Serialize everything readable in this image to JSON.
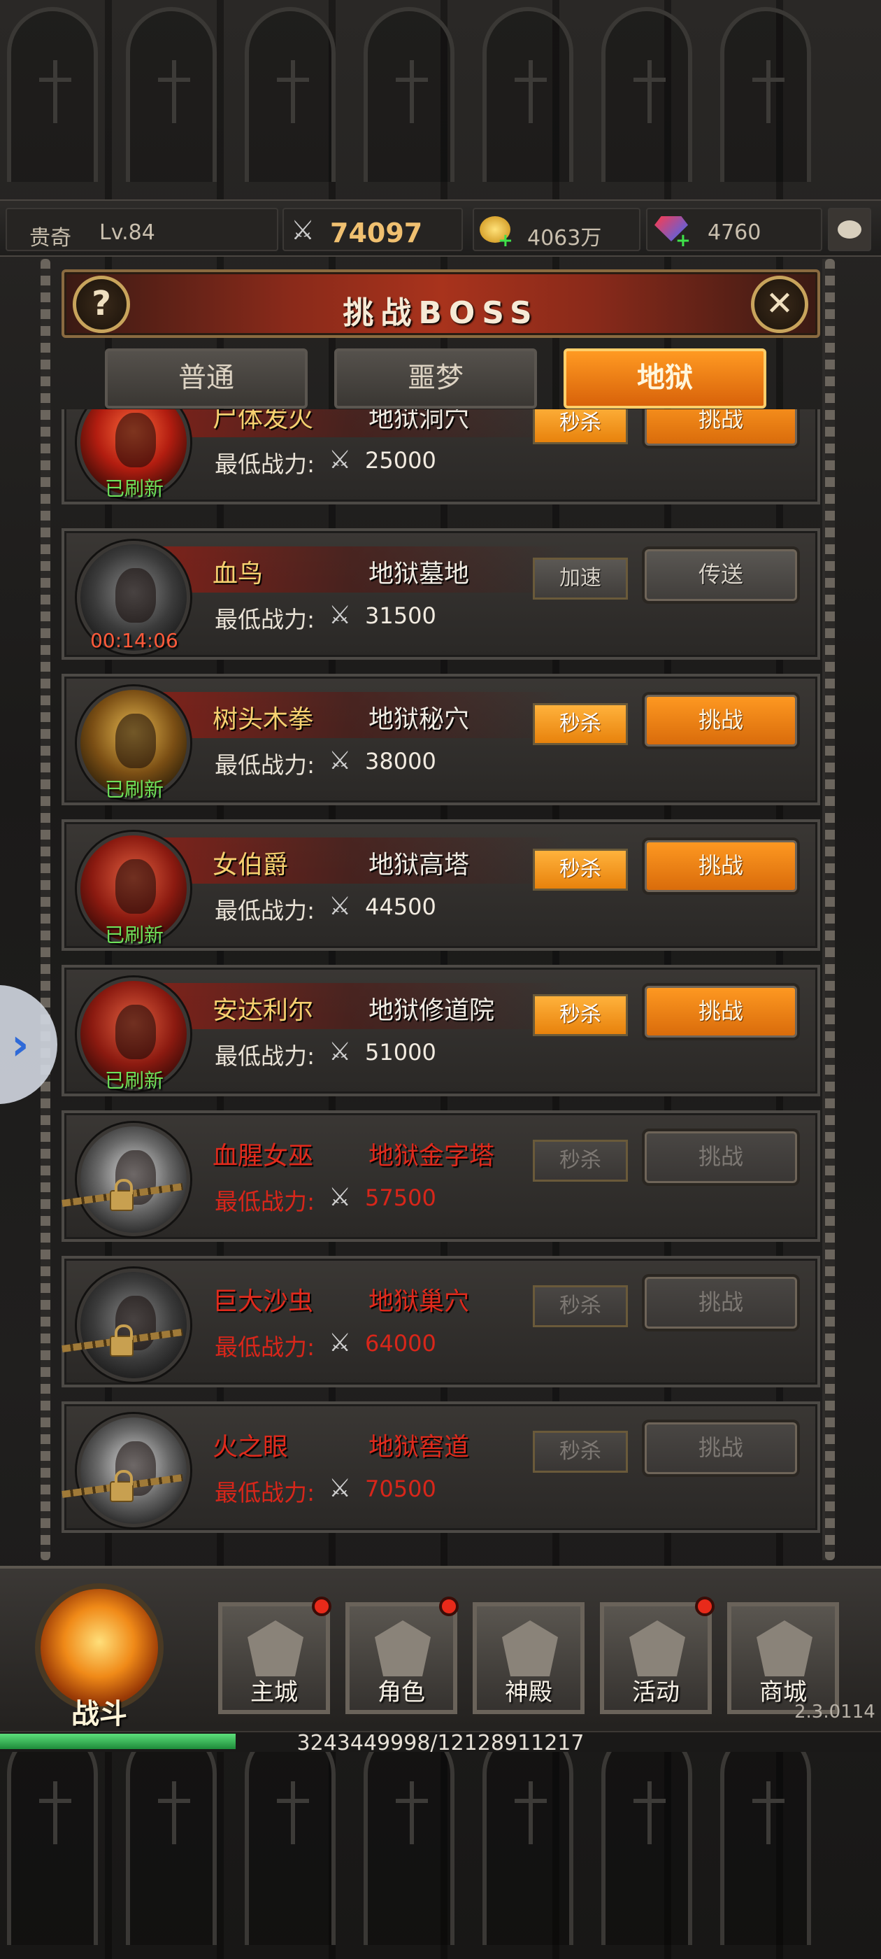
{
  "player": {
    "name": "贵奇",
    "level": "Lv.84"
  },
  "resources": {
    "power": "74097",
    "gold": "4063万",
    "gems": "4760"
  },
  "panel": {
    "title": "挑战BOSS",
    "help_icon": "?",
    "close_icon": "✕"
  },
  "tabs": [
    {
      "label": "普通",
      "active": false
    },
    {
      "label": "噩梦",
      "active": false
    },
    {
      "label": "地狱",
      "active": true
    }
  ],
  "min_power_label": "最低战力:",
  "bosses": [
    {
      "name": "尸体发火",
      "location": "地狱洞穴",
      "min_power": "25000",
      "status": "已刷新",
      "quick_kill": "秒杀",
      "action": "挑战",
      "state": "ready",
      "portrait": "red"
    },
    {
      "name": "血鸟",
      "location": "地狱墓地",
      "min_power": "31500",
      "status": "00:14:06",
      "quick_kill": "加速",
      "action": "传送",
      "state": "cooldown",
      "portrait": "dark"
    },
    {
      "name": "树头木拳",
      "location": "地狱秘穴",
      "min_power": "38000",
      "status": "已刷新",
      "quick_kill": "秒杀",
      "action": "挑战",
      "state": "ready",
      "portrait": "gold"
    },
    {
      "name": "女伯爵",
      "location": "地狱高塔",
      "min_power": "44500",
      "status": "已刷新",
      "quick_kill": "秒杀",
      "action": "挑战",
      "state": "ready",
      "portrait": "crimson"
    },
    {
      "name": "安达利尔",
      "location": "地狱修道院",
      "min_power": "51000",
      "status": "已刷新",
      "quick_kill": "秒杀",
      "action": "挑战",
      "state": "ready",
      "portrait": "crimson"
    },
    {
      "name": "血腥女巫",
      "location": "地狱金字塔",
      "min_power": "57500",
      "status": "",
      "quick_kill": "秒杀",
      "action": "挑战",
      "state": "locked",
      "portrait": "silver"
    },
    {
      "name": "巨大沙虫",
      "location": "地狱巢穴",
      "min_power": "64000",
      "status": "",
      "quick_kill": "秒杀",
      "action": "挑战",
      "state": "locked",
      "portrait": "dark"
    },
    {
      "name": "火之眼",
      "location": "地狱窖道",
      "min_power": "70500",
      "status": "",
      "quick_kill": "秒杀",
      "action": "挑战",
      "state": "locked",
      "portrait": "silver"
    }
  ],
  "nav": {
    "fight": "战斗",
    "items": [
      {
        "label": "主城",
        "badge": true,
        "icon": "castle-icon"
      },
      {
        "label": "角色",
        "badge": true,
        "icon": "helmet-icon"
      },
      {
        "label": "神殿",
        "badge": false,
        "icon": "temple-icon"
      },
      {
        "label": "活动",
        "badge": true,
        "icon": "banner-icon"
      },
      {
        "label": "商城",
        "badge": false,
        "icon": "diamond-icon"
      }
    ]
  },
  "version": "2.3.0114",
  "exp": {
    "text": "3243449998/12128911217",
    "fraction": 0.2674
  },
  "colors": {
    "accent_orange": "#f08a18",
    "refreshed_green": "#6ee25a",
    "locked_red": "#e02a1c",
    "timer_red": "#ff5a3a"
  }
}
